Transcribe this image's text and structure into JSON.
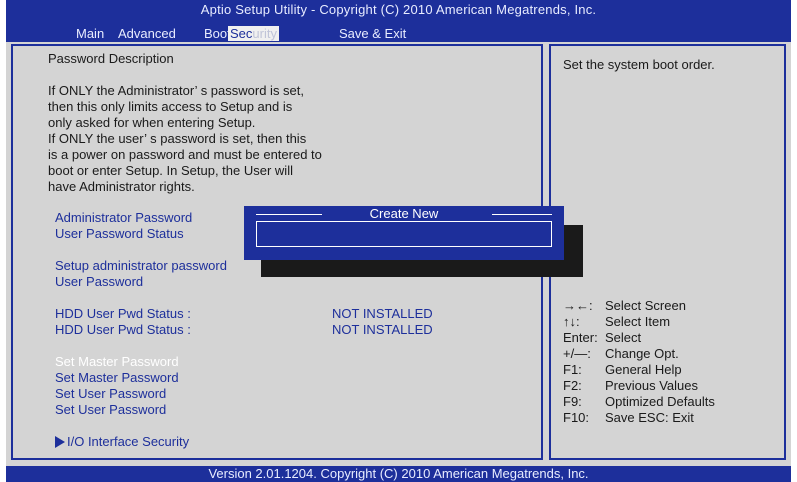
{
  "header": {
    "title": "Aptio Setup Utility - Copyright (C) 2010 American Megatrends, Inc.",
    "tabs": [
      "Main",
      "Advanced",
      "Boot",
      "Security",
      "Save & Exit"
    ],
    "selected_tab": "Security",
    "boot_visible_part": "Boot",
    "security_parts": [
      "Sec",
      "urity"
    ]
  },
  "description": {
    "heading": "Password Description",
    "lines": [
      "If ONLY the Administrator’ s password is set,",
      "then this only limits access to Setup and is",
      "only asked for when entering Setup.",
      "If ONLY the user’ s password is set, then this",
      "is a power on password and must be entered to",
      "boot or enter Setup. In Setup, the User will",
      "have Administrator rights."
    ]
  },
  "items": {
    "admin_password": "Administrator Password",
    "user_password_status": "User Password Status",
    "setup_admin_password": "Setup administrator password",
    "user_password": "User Password",
    "hdd_status_1_label": "HDD User Pwd Status :",
    "hdd_status_1_value": "NOT INSTALLED",
    "hdd_status_2_label": "HDD User Pwd Status :",
    "hdd_status_2_value": "NOT INSTALLED",
    "set_master_1": "Set Master Password",
    "set_master_2": "Set Master Password",
    "set_user_1": "Set User Password",
    "set_user_2": "Set User Password",
    "io_security": "I/O Interface Security"
  },
  "dialog": {
    "title": "Create New",
    "input_value": ""
  },
  "help": {
    "text": "Set the system boot order."
  },
  "legend": [
    {
      "key": "→←:",
      "label": "Select Screen"
    },
    {
      "key": "↑↓:",
      "label": "Select Item"
    },
    {
      "key": "Enter:",
      "label": "Select"
    },
    {
      "key": "+/—:",
      "label": "Change Opt."
    },
    {
      "key": "F1:",
      "label": "General Help"
    },
    {
      "key": "F2:",
      "label": "Previous Values"
    },
    {
      "key": "F9:",
      "label": "Optimized Defaults"
    },
    {
      "key": "F10:",
      "label": "Save    ESC: Exit"
    }
  ],
  "footer": {
    "text": "Version 2.01.1204. Copyright (C) 2010 American Megatrends, Inc."
  },
  "colors": {
    "bios_blue": "#1d2f9b",
    "panel_gray": "#d4d4d4",
    "highlight": "#ffffff"
  }
}
